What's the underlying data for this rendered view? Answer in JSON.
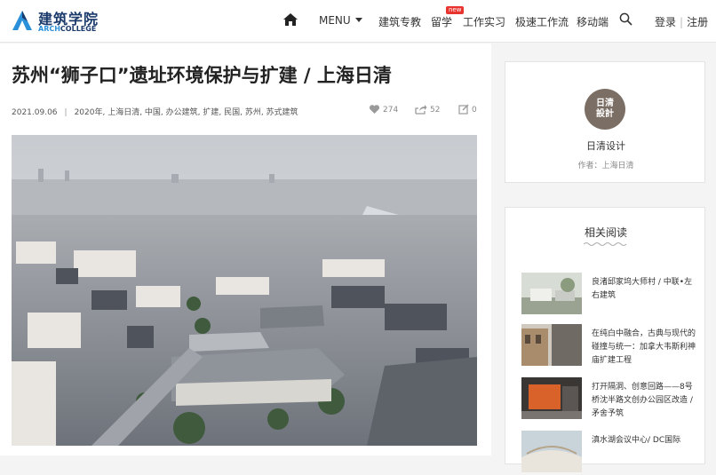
{
  "header": {
    "logo_cn": "建筑学院",
    "logo_en_a": "ARCH",
    "logo_en_b": "COLLEGE",
    "menu_label": "MENU",
    "nav": [
      "建筑专教",
      "留学",
      "工作实习",
      "极速工作流",
      "移动端"
    ],
    "new_badge": "new",
    "login": "登录",
    "register": "注册"
  },
  "article": {
    "title": "苏州“狮子口”遗址环境保护与扩建 / 上海日清",
    "date": "2021.09.06",
    "tags": "2020年, 上海日清, 中国, 办公建筑, 扩建, 民国, 苏州, 苏式建筑",
    "likes": "274",
    "shares": "52",
    "comments": "0"
  },
  "author": {
    "avatar_line1": "日清",
    "avatar_line2": "設計",
    "name": "日清设计",
    "line": "作者：上海日清"
  },
  "related": {
    "title": "相关阅读",
    "items": [
      "良渚邱家坞大师村 / 中联•左右建筑",
      "在纯白中融合，古典与现代的碰撞与统一：加拿大韦斯利神庙扩建工程",
      "打开隔洞、创意回路——8号桥沈半路文创办公园区改造 / 矛舍予筑",
      "滇水湖会议中心/ DC国际"
    ]
  },
  "colors": {
    "brand": "#1b3a6b",
    "accent": "#2a90d9",
    "badge": "#e8332f"
  }
}
